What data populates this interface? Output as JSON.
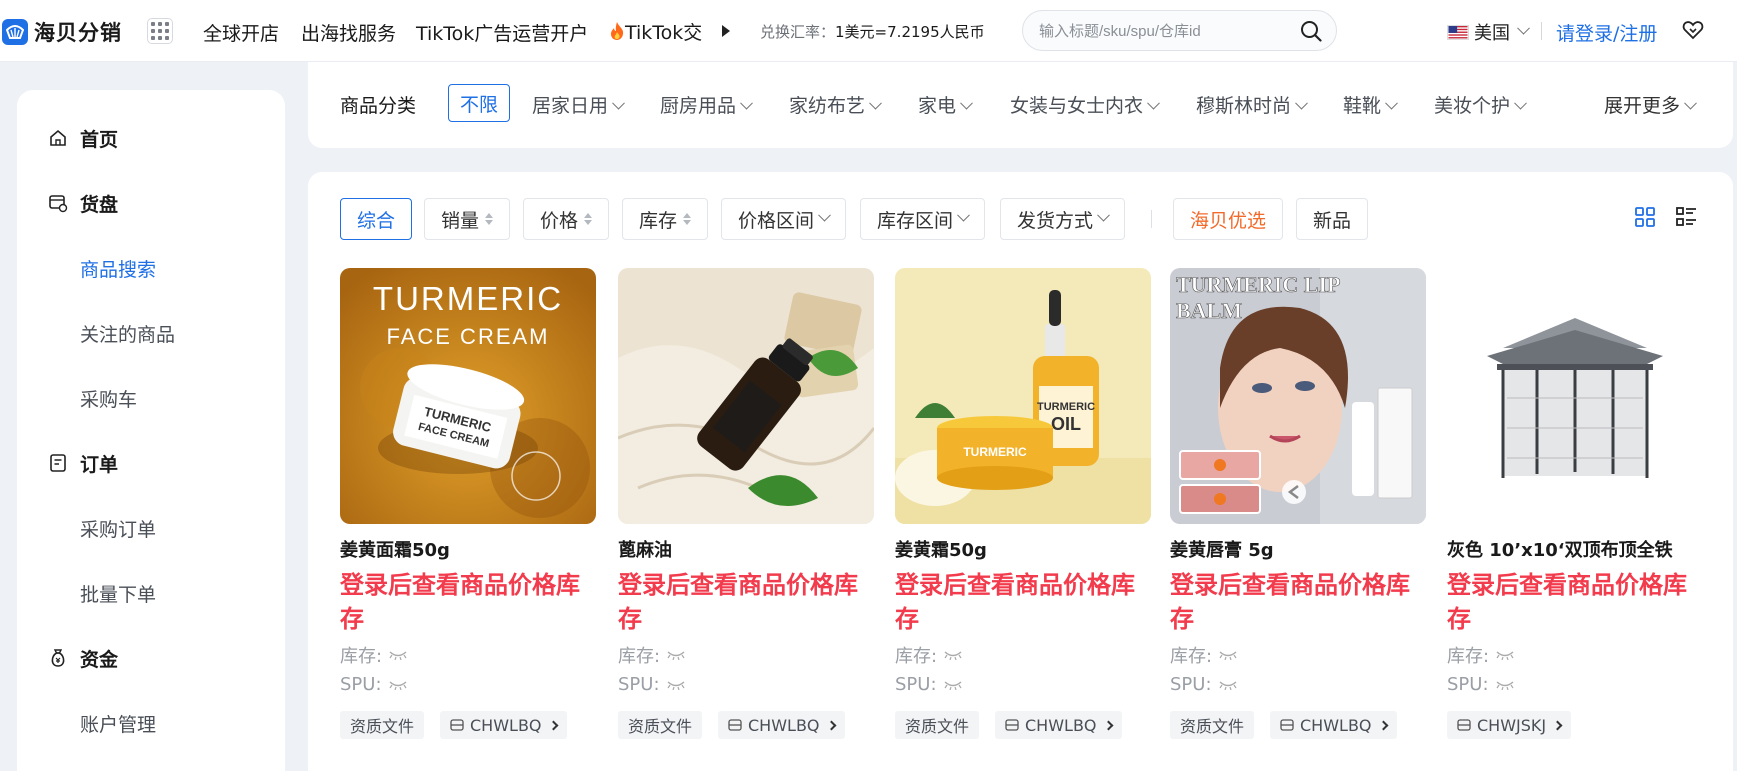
{
  "brand": {
    "name": "海贝分销",
    "accent": "#1f6fe5"
  },
  "topnav": [
    {
      "label": "全球开店"
    },
    {
      "label": "出海找服务"
    },
    {
      "label": "TikTok广告运营开户"
    },
    {
      "label": "TikTok交"
    }
  ],
  "rate": {
    "label": "兑换汇率：",
    "value": "1美元=7.2195人民币"
  },
  "search": {
    "placeholder": "输入标题/sku/spu/仓库id",
    "value": ""
  },
  "region": {
    "label": "美国"
  },
  "login": {
    "label": "请登录/注册"
  },
  "sidebar": {
    "items": [
      {
        "label": "首页",
        "type": "main",
        "icon": "home-icon"
      },
      {
        "label": "货盘",
        "type": "main",
        "icon": "goods-icon"
      },
      {
        "label": "商品搜索",
        "type": "sub",
        "active": true
      },
      {
        "label": "关注的商品",
        "type": "sub"
      },
      {
        "label": "采购车",
        "type": "sub"
      },
      {
        "label": "订单",
        "type": "main",
        "icon": "order-icon"
      },
      {
        "label": "采购订单",
        "type": "sub"
      },
      {
        "label": "批量下单",
        "type": "sub"
      },
      {
        "label": "资金",
        "type": "main",
        "icon": "money-bag-icon"
      },
      {
        "label": "账户管理",
        "type": "sub"
      }
    ]
  },
  "categories": {
    "label": "商品分类",
    "all": "不限",
    "items": [
      "居家日用",
      "厨房用品",
      "家纺布艺",
      "家电",
      "女装与女士内衣",
      "穆斯林时尚",
      "鞋靴",
      "美妆个护"
    ],
    "more": "展开更多"
  },
  "filters": {
    "items": [
      {
        "label": "综合",
        "active": true
      },
      {
        "label": "销量",
        "sort": true
      },
      {
        "label": "价格",
        "sort": true
      },
      {
        "label": "库存",
        "sort": true
      },
      {
        "label": "价格区间",
        "dropdown": true
      },
      {
        "label": "库存区间",
        "dropdown": true
      },
      {
        "label": "发货方式",
        "dropdown": true
      }
    ],
    "featured": "海贝优选",
    "new": "新品"
  },
  "product_common": {
    "price_text": "登录后查看商品价格库存",
    "stock_label": "库存:",
    "spu_label": "SPU:",
    "cert_label": "资质文件"
  },
  "products": [
    {
      "title": "姜黄面霜50g",
      "warehouse": "CHWLBQ",
      "has_cert": true,
      "image_text_1": "TURMERIC",
      "image_text_2": "FACE CREAM",
      "jar_text_1": "TURMERIC",
      "jar_text_2": "FACE CREAM"
    },
    {
      "title": "蓖麻油",
      "warehouse": "CHWLBQ",
      "has_cert": true
    },
    {
      "title": "姜黄霜50g",
      "warehouse": "CHWLBQ",
      "has_cert": true,
      "jar_text_1": "TURMERIC",
      "bottle_text_1": "TURMERIC",
      "bottle_text_2": "OIL"
    },
    {
      "title": "姜黄唇膏 5g",
      "warehouse": "CHWLBQ",
      "has_cert": true,
      "image_text_1": "TURMERIC LIP",
      "image_text_2": "BALM"
    },
    {
      "title": "灰色 10’x10‘双顶布顶全铁",
      "warehouse": "CHWJSKJ",
      "has_cert": false
    }
  ]
}
